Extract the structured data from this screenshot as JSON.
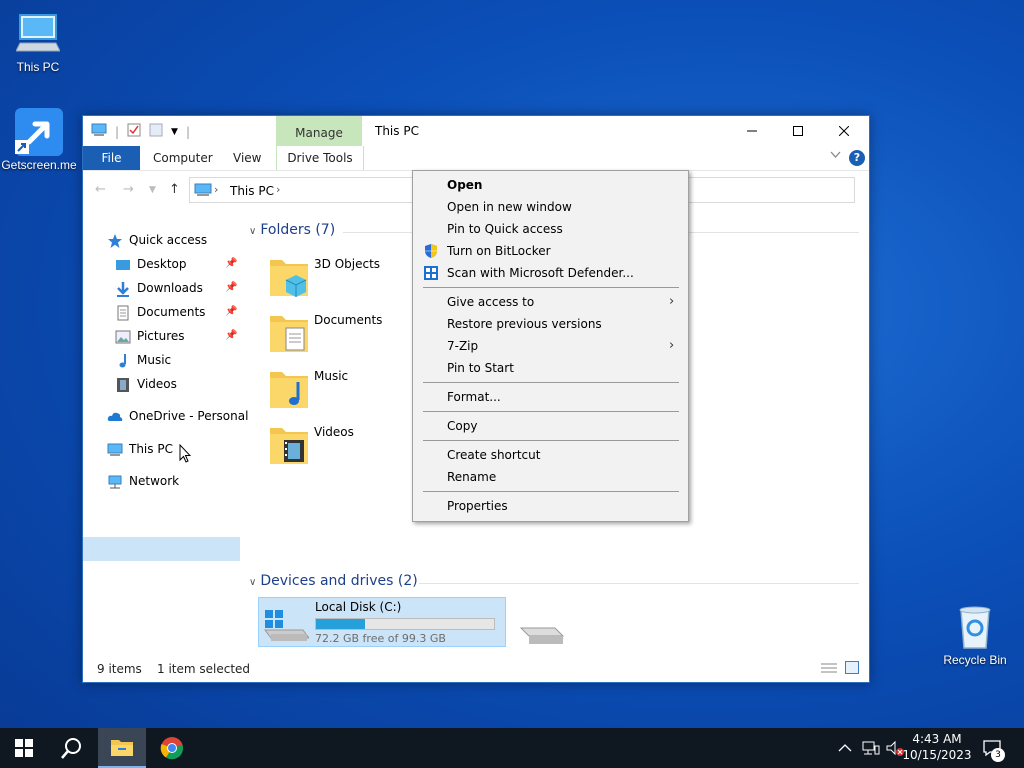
{
  "desktop": {
    "icons": [
      {
        "label": "This PC"
      },
      {
        "label": "Getscreen.me"
      },
      {
        "label": "Recycle Bin"
      }
    ]
  },
  "window": {
    "title": "This PC",
    "manage_tab": "Manage",
    "ribbon_tabs": {
      "file": "File",
      "computer": "Computer",
      "view": "View",
      "drive_tools": "Drive Tools"
    },
    "help_label": "?",
    "address": {
      "path": "This PC"
    },
    "nav": {
      "quick_access": "Quick access",
      "desktop": "Desktop",
      "downloads": "Downloads",
      "documents": "Documents",
      "pictures": "Pictures",
      "music": "Music",
      "videos": "Videos",
      "onedrive": "OneDrive - Personal",
      "this_pc": "This PC",
      "network": "Network"
    },
    "folders_header": "Folders (7)",
    "folders": [
      "3D Objects",
      "Documents",
      "Music",
      "Videos"
    ],
    "devices_header": "Devices and drives (2)",
    "drive": {
      "name": "Local Disk (C:)",
      "free": "72.2 GB free of 99.3 GB",
      "used_fraction": 0.273
    },
    "status": {
      "items": "9 items",
      "selected": "1 item selected"
    }
  },
  "context_menu": {
    "items": [
      "Open",
      "Open in new window",
      "Pin to Quick access",
      "Turn on BitLocker",
      "Scan with Microsoft Defender...",
      "Give access to",
      "Restore previous versions",
      "7-Zip",
      "Pin to Start",
      "Format...",
      "Copy",
      "Create shortcut",
      "Rename",
      "Properties"
    ]
  },
  "taskbar": {
    "time": "4:43 AM",
    "date": "10/15/2023",
    "notification_count": "3"
  },
  "colors": {
    "accent": "#1a5fb4",
    "selection": "#cce4f7",
    "manage_tab": "#c8e6bc",
    "drive_fill": "#26a0da"
  }
}
